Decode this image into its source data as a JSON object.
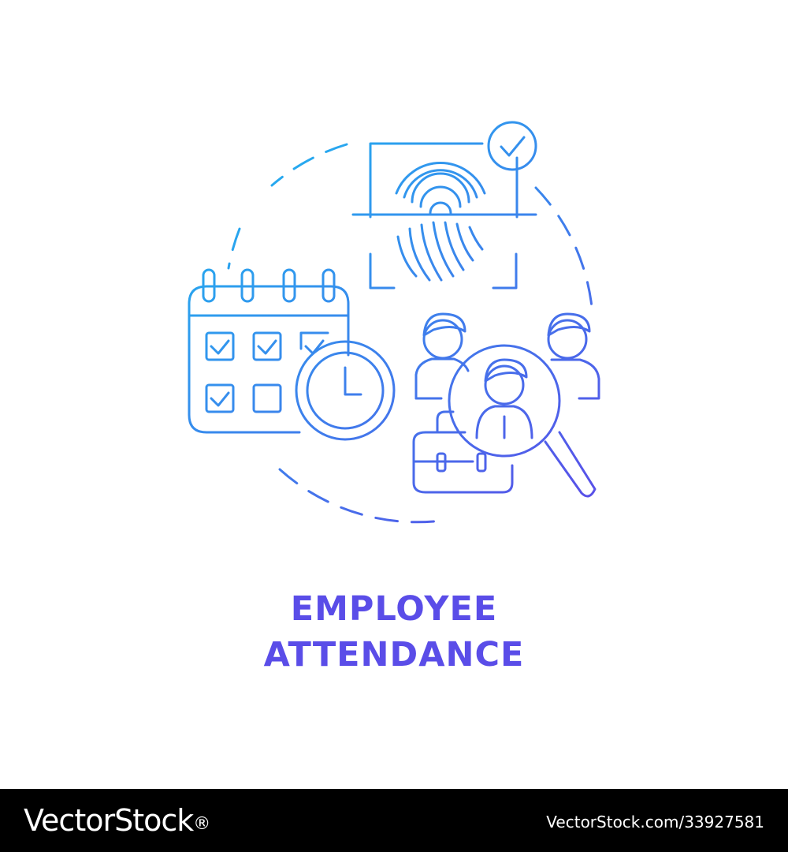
{
  "title": {
    "line1": "EMPLOYEE",
    "line2": "ATTENDANCE",
    "color": "#5a4de8"
  },
  "illustration": {
    "icons": [
      "fingerprint-scanner-icon",
      "check-badge-icon",
      "calendar-icon",
      "clock-icon",
      "employees-icon",
      "magnifier-icon",
      "briefcase-icon"
    ],
    "gradient_start": "#1fb6f0",
    "gradient_end": "#5a4de8"
  },
  "footer": {
    "brand": "VectorStock",
    "registered_mark": "®",
    "credit": "VectorStock.com/33927581",
    "background": "#000000",
    "text_color": "#ffffff"
  }
}
